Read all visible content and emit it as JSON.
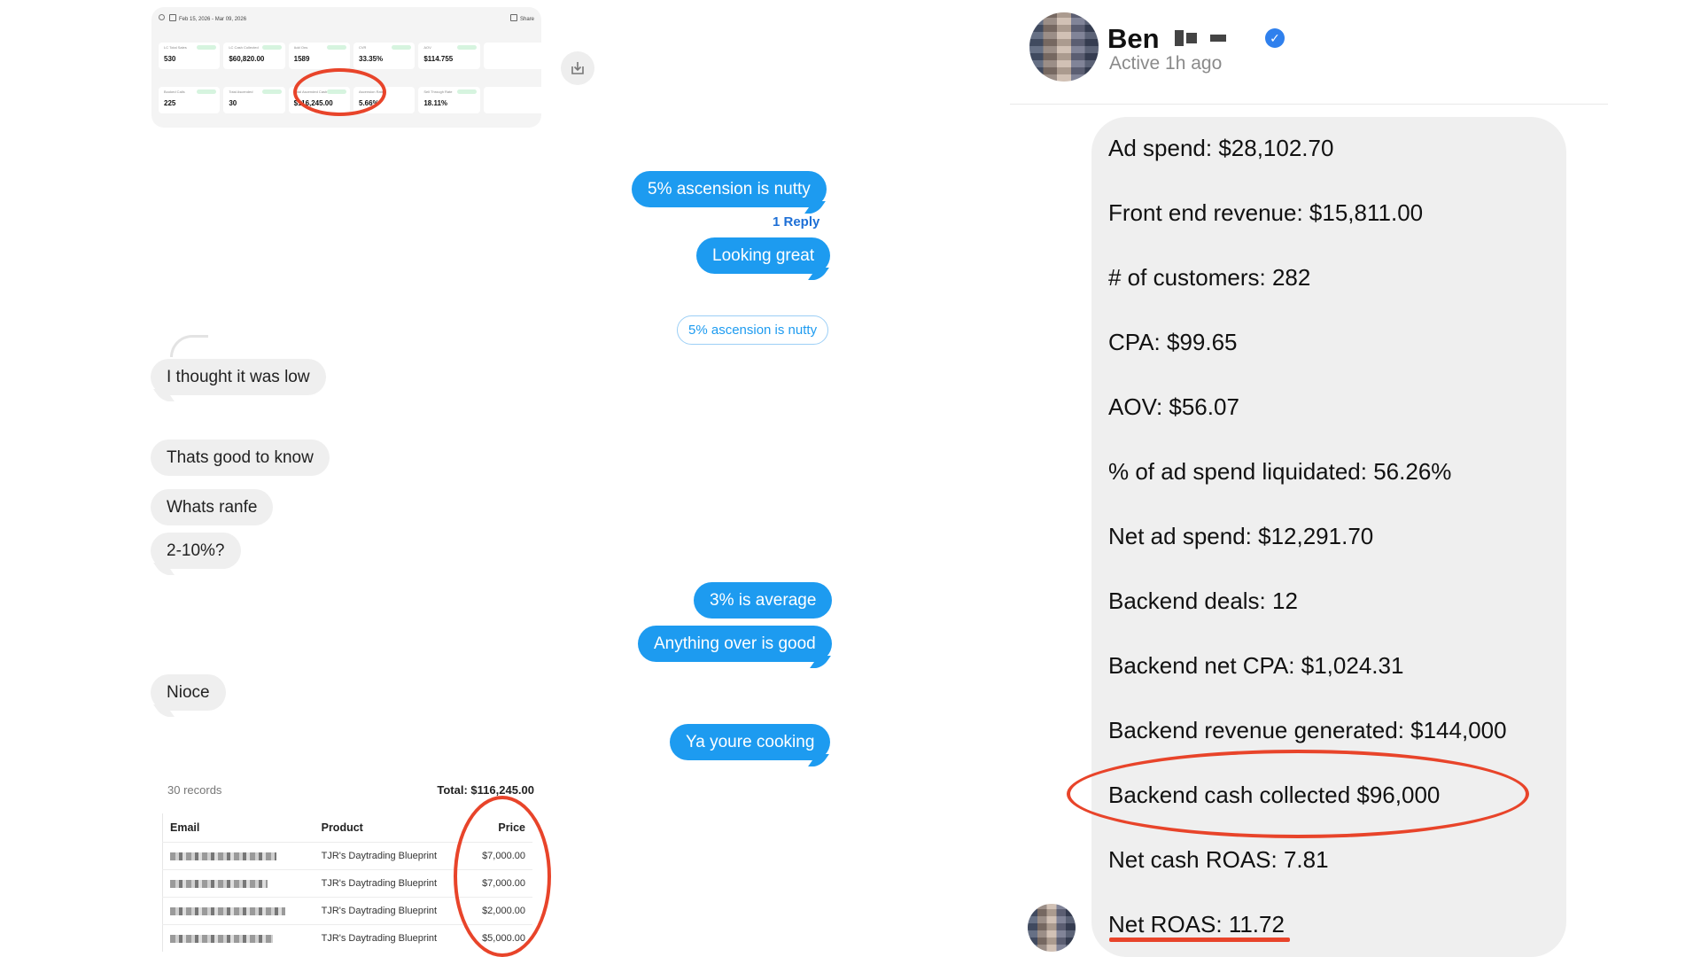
{
  "dashboard": {
    "date_range": "Feb 15, 2026 - Mar 09, 2026",
    "share_label": "Share",
    "cards": [
      {
        "label": "LC Total Sales",
        "value": "530"
      },
      {
        "label": "LC Cash Collected",
        "value": "$60,820.00"
      },
      {
        "label": "Add Ons",
        "value": "1589"
      },
      {
        "label": "CVR",
        "value": "33.35%"
      },
      {
        "label": "AOV",
        "value": "$114.755"
      },
      {
        "label": "",
        "value": ""
      },
      {
        "label": "Booked Calls",
        "value": "225"
      },
      {
        "label": "Total Ascended",
        "value": "30"
      },
      {
        "label": "Total Ascended Cash",
        "value": "$116,245.00"
      },
      {
        "label": "Ascension Rate",
        "value": "5.66%"
      },
      {
        "label": "Sell Through Rate",
        "value": "18.11%"
      },
      {
        "label": "",
        "value": ""
      }
    ]
  },
  "chat_left": {
    "messages": [
      {
        "text": "5% ascension is nutty"
      },
      {
        "text": "1 Reply"
      },
      {
        "text": "Looking great"
      },
      {
        "text": "5% ascension is nutty"
      },
      {
        "text": "I thought it was low"
      },
      {
        "text": "Thats good to know"
      },
      {
        "text": "Whats ranfe"
      },
      {
        "text": "2-10%?"
      },
      {
        "text": "3% is average"
      },
      {
        "text": "Anything over is good"
      },
      {
        "text": "Nioce"
      },
      {
        "text": "Ya youre cooking"
      }
    ]
  },
  "records": {
    "count": "30 records",
    "total": "Total: $116,245.00",
    "headers": [
      "Email",
      "Product",
      "Price"
    ],
    "rows": [
      {
        "product": "TJR's Daytrading Blueprint",
        "price": "$7,000.00"
      },
      {
        "product": "TJR's Daytrading Blueprint",
        "price": "$7,000.00"
      },
      {
        "product": "TJR's Daytrading Blueprint",
        "price": "$2,000.00"
      },
      {
        "product": "TJR's Daytrading Blueprint",
        "price": "$5,000.00"
      }
    ]
  },
  "profile": {
    "name": "Ben",
    "status": "Active 1h ago"
  },
  "stats": [
    "Ad spend: $28,102.70",
    "Front end revenue: $15,811.00",
    "# of customers: 282",
    "CPA: $99.65",
    "AOV: $56.07",
    "% of ad spend liquidated: 56.26%",
    "Net ad spend: $12,291.70",
    "Backend deals: 12",
    "Backend net CPA: $1,024.31",
    "Backend revenue generated: $144,000",
    "Backend cash collected $96,000",
    "Net cash ROAS: 7.81",
    "Net ROAS: 11.72"
  ],
  "colors": {
    "outgoing_bubble": "#1d9bf0",
    "incoming_bubble": "#efefef",
    "highlight_red": "#e8442a",
    "verified_blue": "#2f80ed"
  }
}
